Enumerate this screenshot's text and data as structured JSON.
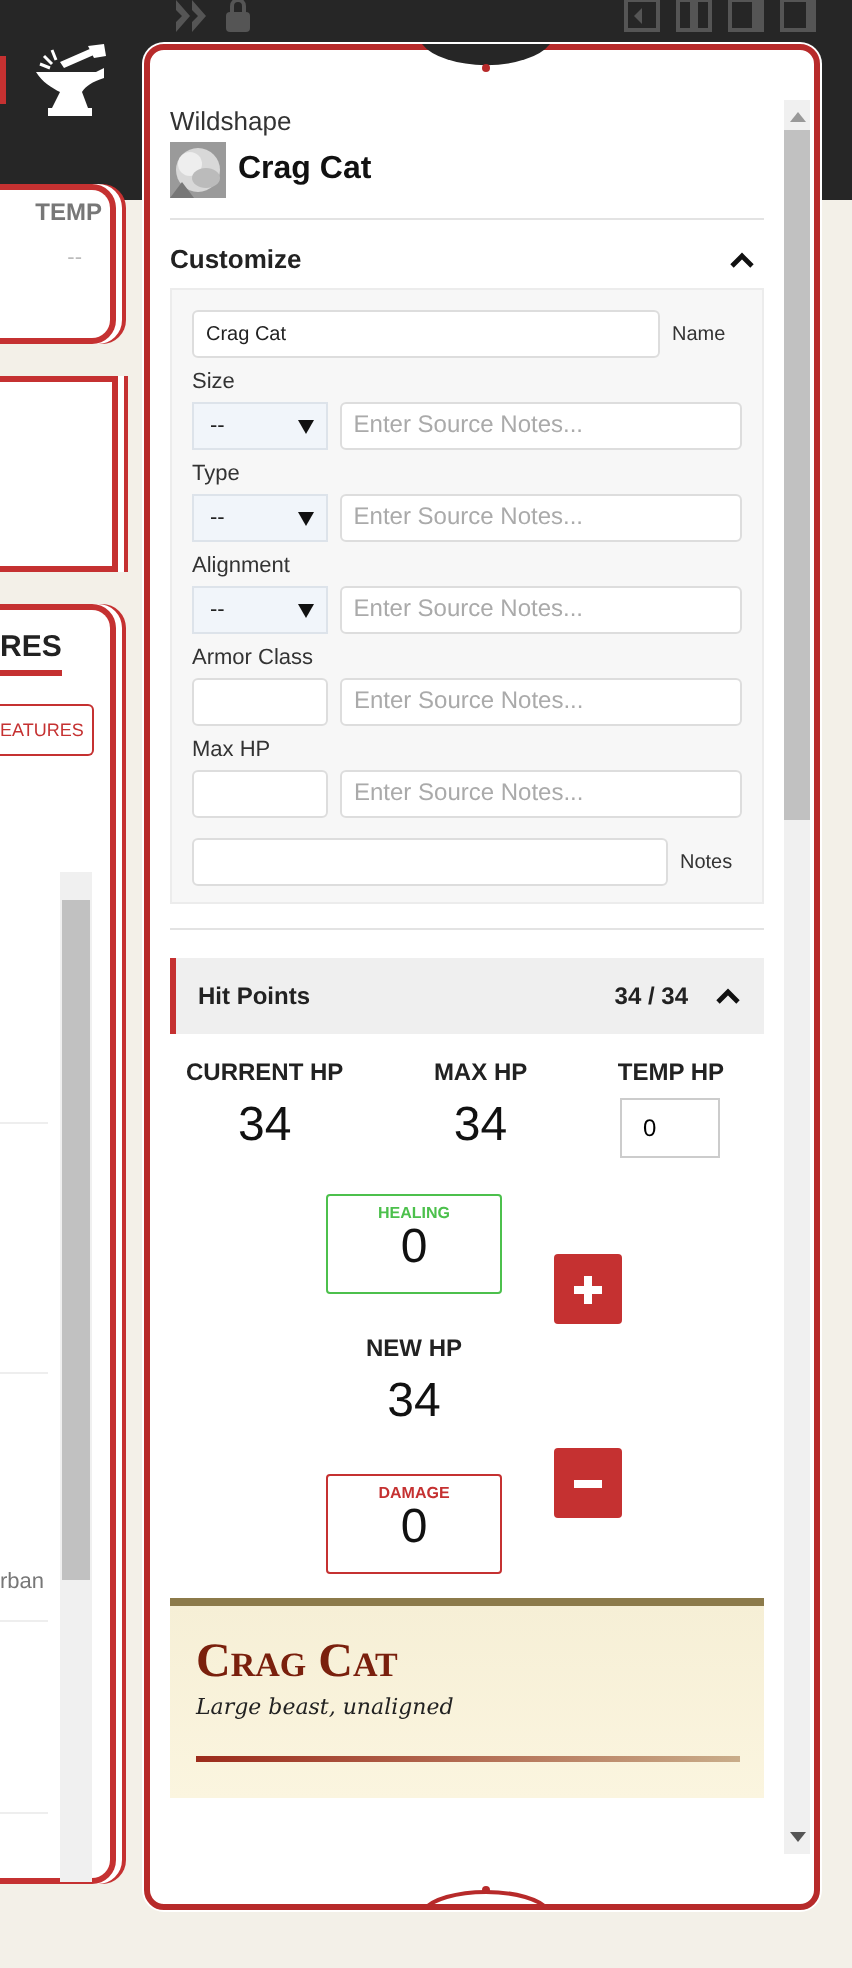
{
  "left_panel": {
    "temp_label": "TEMP",
    "temp_value": "--",
    "tab_label": "RES",
    "features_button": "EATURES",
    "row_text": "rban"
  },
  "sidebar": {
    "kicker": "Wildshape",
    "title": "Crag Cat",
    "customize": {
      "title": "Customize",
      "expanded": true,
      "name_value": "Crag Cat",
      "name_label": "Name",
      "fields": [
        {
          "label": "Size",
          "kind": "select",
          "value": "--",
          "placeholder": "Enter Source Notes..."
        },
        {
          "label": "Type",
          "kind": "select",
          "value": "--",
          "placeholder": "Enter Source Notes..."
        },
        {
          "label": "Alignment",
          "kind": "select",
          "value": "--",
          "placeholder": "Enter Source Notes..."
        },
        {
          "label": "Armor Class",
          "kind": "input",
          "placeholder": "Enter Source Notes..."
        },
        {
          "label": "Max HP",
          "kind": "input",
          "placeholder": "Enter Source Notes..."
        }
      ],
      "notes_label": "Notes"
    },
    "hit_points": {
      "title": "Hit Points",
      "summary": "34 / 34",
      "expanded": true,
      "columns": [
        {
          "label": "CURRENT HP",
          "kind": "text",
          "value": "34"
        },
        {
          "label": "MAX HP",
          "kind": "text",
          "value": "34"
        },
        {
          "label": "TEMP HP",
          "kind": "input",
          "value": "0"
        }
      ],
      "healing": {
        "label": "HEALING",
        "value": "0"
      },
      "new_hp": {
        "label": "NEW HP",
        "value": "34"
      },
      "damage": {
        "label": "DAMAGE",
        "value": "0"
      }
    },
    "stat_block": {
      "name": "Crag Cat",
      "subtitle": "Large beast, unaligned"
    }
  }
}
